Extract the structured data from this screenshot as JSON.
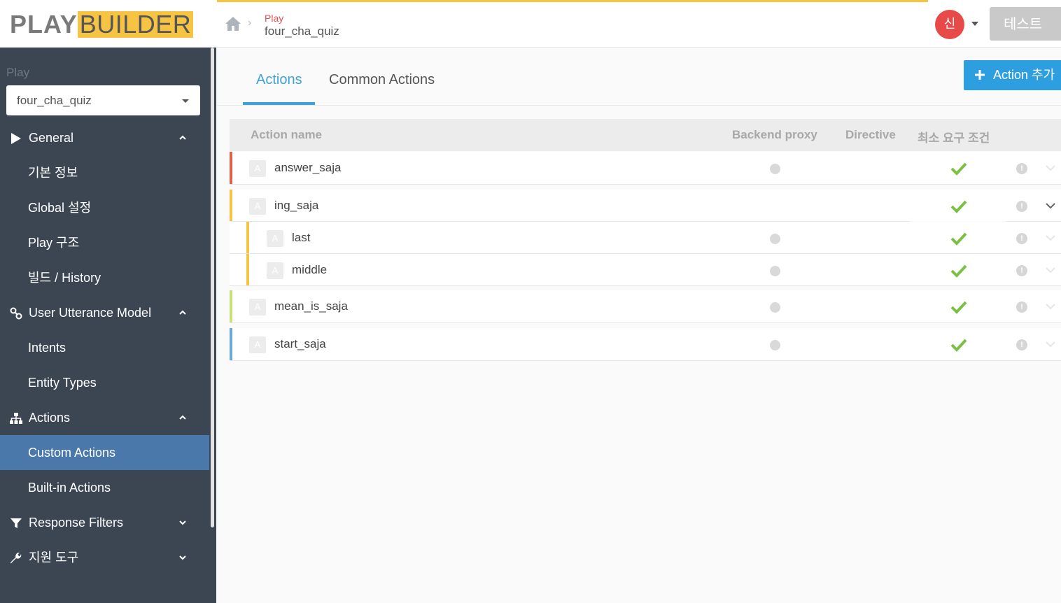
{
  "header": {
    "logo_play": "PLAY",
    "logo_builder": "BUILDER",
    "breadcrumb_top": "Play",
    "breadcrumb_main": "four_cha_quiz",
    "avatar_initial": "신",
    "test_button": "테스트",
    "home_icon": "home-icon"
  },
  "sidebar": {
    "play_label": "Play",
    "play_select_value": "four_cha_quiz",
    "items": [
      {
        "label": "General",
        "icon": "play-triangle-icon",
        "chevron": "up"
      },
      {
        "label": "기본 정보"
      },
      {
        "label": "Global 설정"
      },
      {
        "label": "Play 구조"
      },
      {
        "label": "빌드 / History"
      },
      {
        "label": "User Utterance Model",
        "icon": "link-icon",
        "chevron": "up"
      },
      {
        "label": "Intents"
      },
      {
        "label": "Entity Types"
      },
      {
        "label": "Actions",
        "icon": "sitemap-icon",
        "chevron": "up"
      },
      {
        "label": "Custom Actions",
        "active": true
      },
      {
        "label": "Built-in Actions"
      },
      {
        "label": "Response Filters",
        "icon": "filter-icon",
        "chevron": "down"
      },
      {
        "label": "지원 도구",
        "icon": "wrench-icon",
        "chevron": "down"
      }
    ]
  },
  "main": {
    "tabs": [
      {
        "label": "Actions",
        "active": true
      },
      {
        "label": "Common Actions"
      }
    ],
    "add_button": "Action 추가",
    "table": {
      "headers": [
        "Action name",
        "Backend proxy",
        "Directive",
        "최소 요구 조건"
      ],
      "rows": [
        {
          "badge": "A",
          "name": "answer_saja",
          "color": "#e0614a",
          "backend_dot": true
        },
        {
          "badge": "A",
          "name": "ing_saja",
          "color": "#f6c343",
          "backend_dot": false,
          "expanded": true
        },
        {
          "badge": "A",
          "name": "last",
          "color": "#f6c343",
          "backend_dot": true,
          "child": true
        },
        {
          "badge": "A",
          "name": "middle",
          "color": "#f6c343",
          "backend_dot": true,
          "child": true
        },
        {
          "badge": "A",
          "name": "mean_is_saja",
          "color": "#c8e07a",
          "backend_dot": true
        },
        {
          "badge": "A",
          "name": "start_saja",
          "color": "#6aa8d8",
          "backend_dot": true
        }
      ]
    }
  },
  "colors": {
    "accent": "#3fa1d8",
    "sidebar_bg": "#3c4653",
    "active_item": "#4a78ab",
    "logo_yellow": "#f6c343",
    "check_green": "#7ac143"
  }
}
